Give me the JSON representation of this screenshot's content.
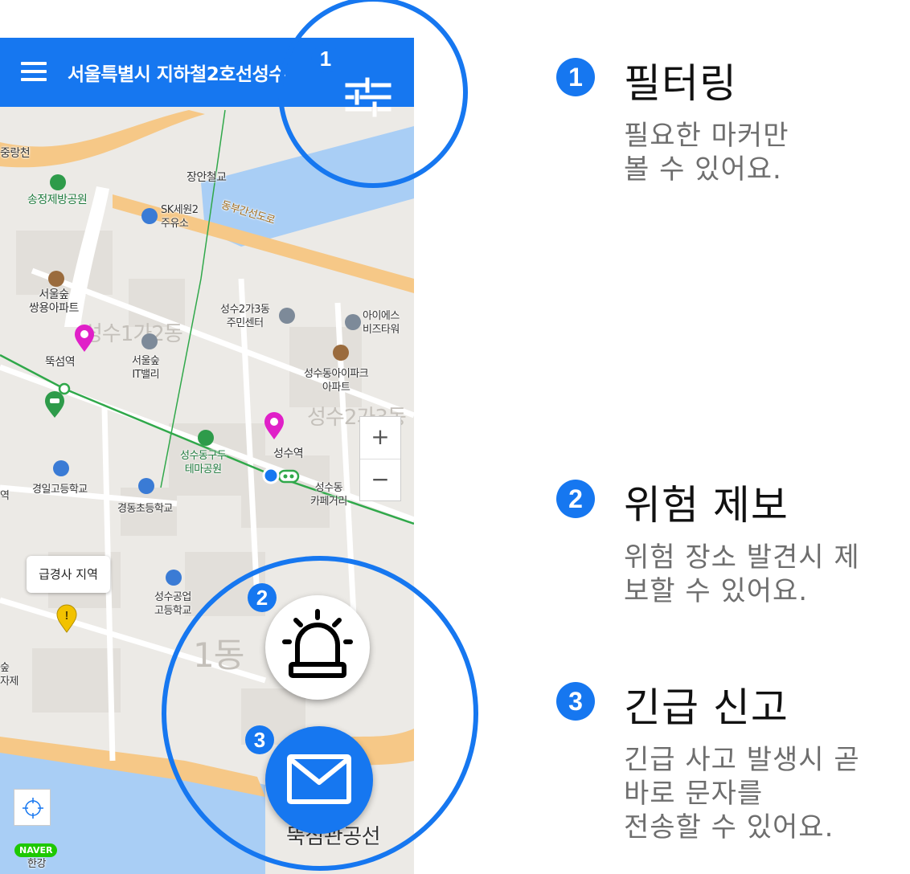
{
  "app_bar": {
    "title": "서울특별시 지하철2호선성수",
    "menu_icon": "hamburger-menu-icon",
    "filter_icon": "filter-sliders-icon"
  },
  "map": {
    "labels": {
      "jungnangcheon": "중랑천",
      "jangan_bridge": "장안철교",
      "songjeong_park": "송정제방공원",
      "sk_gas": "SK세원2\n주유소",
      "dongbu_road": "동부간선도로",
      "seoulsup_apt": "서울숲\n쌍용아파트",
      "seongsu2ga3_center": "성수2가3동\n주민센터",
      "ies_tower": "아이에스\n비즈타워",
      "ttukseom_station": "뚝섬역",
      "seoulsup_it": "서울숲\nIT밸리",
      "seongsu_ipark": "성수동아이파크\n아파트",
      "seongsu_station": "성수역",
      "gudu_park": "성수동구두\n테마공원",
      "gyeongil_school": "경일고등학교",
      "gyeongdong_school": "경동초등학교",
      "cafe_street": "성수동\n카페거리",
      "seongsu_tech": "성수공업\n고등학교",
      "ttukseom_center": "뚝섬관공선",
      "hangang": "한강",
      "left_station": "역",
      "left_sup": "숲\n자제"
    },
    "districts": {
      "seongsu1ga2": "성수1가2동",
      "seongsu2ga3": "성수2가3동",
      "seongsu1": "1동"
    },
    "tooltip": "급경사 지역",
    "zoom_in": "+",
    "zoom_out": "−",
    "naver_logo": "NAVER",
    "colors": {
      "primary": "#1677f0",
      "hazard_marker": "#e020c8",
      "warning_marker": "#f2c200",
      "river": "#a9cef5",
      "major_road": "#f6c887"
    }
  },
  "fabs": {
    "alert_icon": "siren-alarm-icon",
    "sos_icon": "envelope-icon"
  },
  "badges": [
    "1",
    "2",
    "3"
  ],
  "features": [
    {
      "num": "1",
      "title": "필터링",
      "body": [
        "필요한 마커만",
        "볼 수 있어요."
      ]
    },
    {
      "num": "2",
      "title": "위험 제보",
      "body": [
        "위험 장소 발견시 제",
        "보할 수 있어요."
      ]
    },
    {
      "num": "3",
      "title": "긴급 신고",
      "body": [
        "긴급 사고 발생시 곧",
        "바로 문자를",
        "전송할 수 있어요."
      ]
    }
  ]
}
